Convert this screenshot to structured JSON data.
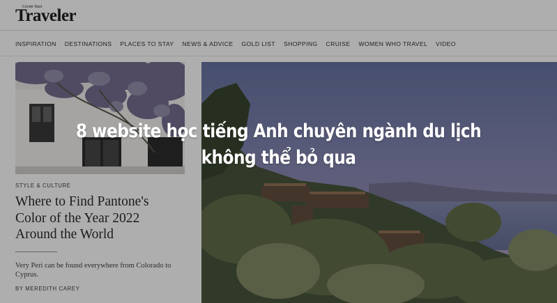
{
  "header": {
    "logo_small": "Condé Nast",
    "logo_main": "Traveler"
  },
  "nav": {
    "items": [
      "INSPIRATION",
      "DESTINATIONS",
      "PLACES TO STAY",
      "NEWS & ADVICE",
      "GOLD LIST",
      "SHOPPING",
      "CRUISE",
      "WOMEN WHO TRAVEL",
      "VIDEO"
    ]
  },
  "card": {
    "kicker": "STYLE & CULTURE",
    "headline": "Where to Find Pantone's Color of the Year 2022 Around the World",
    "dek": "Very Peri can be found everywhere from Colorado to Cyprus.",
    "byline": "BY MEREDITH CAREY"
  },
  "overlay": {
    "line1": "8 website học tiếng Anh chuyên ngành du lịch",
    "line2": "không thể bỏ qua"
  },
  "colors": {
    "page_bg": "#ffffff",
    "text": "#1a1a1a",
    "dim_overlay": "rgba(30,30,30,0.36)",
    "caption_text": "#ffffff"
  }
}
